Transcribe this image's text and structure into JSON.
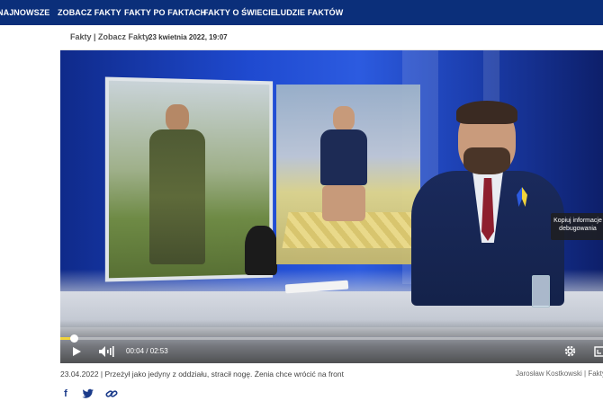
{
  "nav": {
    "items": [
      "NAJNOWSZE",
      "ZOBACZ FAKTY",
      "FAKTY PO FAKTACH",
      "FAKTY O ŚWIECIE",
      "LUDZIE FAKTÓW"
    ]
  },
  "video_header": {
    "brand": "Fakty | Zobacz Fakty",
    "date": "23 kwietnia 2022, 19:07"
  },
  "player": {
    "time": "00:04 / 02:53",
    "progress": 0.025,
    "progress_color": "#f2d43a",
    "tooltip": {
      "line1": "Kopiuj informacje",
      "line2": "debugowania"
    },
    "icons": [
      "play-icon",
      "volume-icon",
      "settings-icon",
      "fullscreen-icon"
    ]
  },
  "caption": {
    "text": "23.04.2022 | Przeżył jako jedyny z oddziału, stracił nogę. Żenia chce wrócić na front",
    "author": "Jarosław Kostkowski | Fakty"
  },
  "share": {
    "icons": [
      "facebook-icon",
      "twitter-icon",
      "link-icon"
    ]
  },
  "colors": {
    "nav_bg": "#0b2f7a",
    "accent": "#f2d43a",
    "share_icon": "#1a3a8a"
  }
}
